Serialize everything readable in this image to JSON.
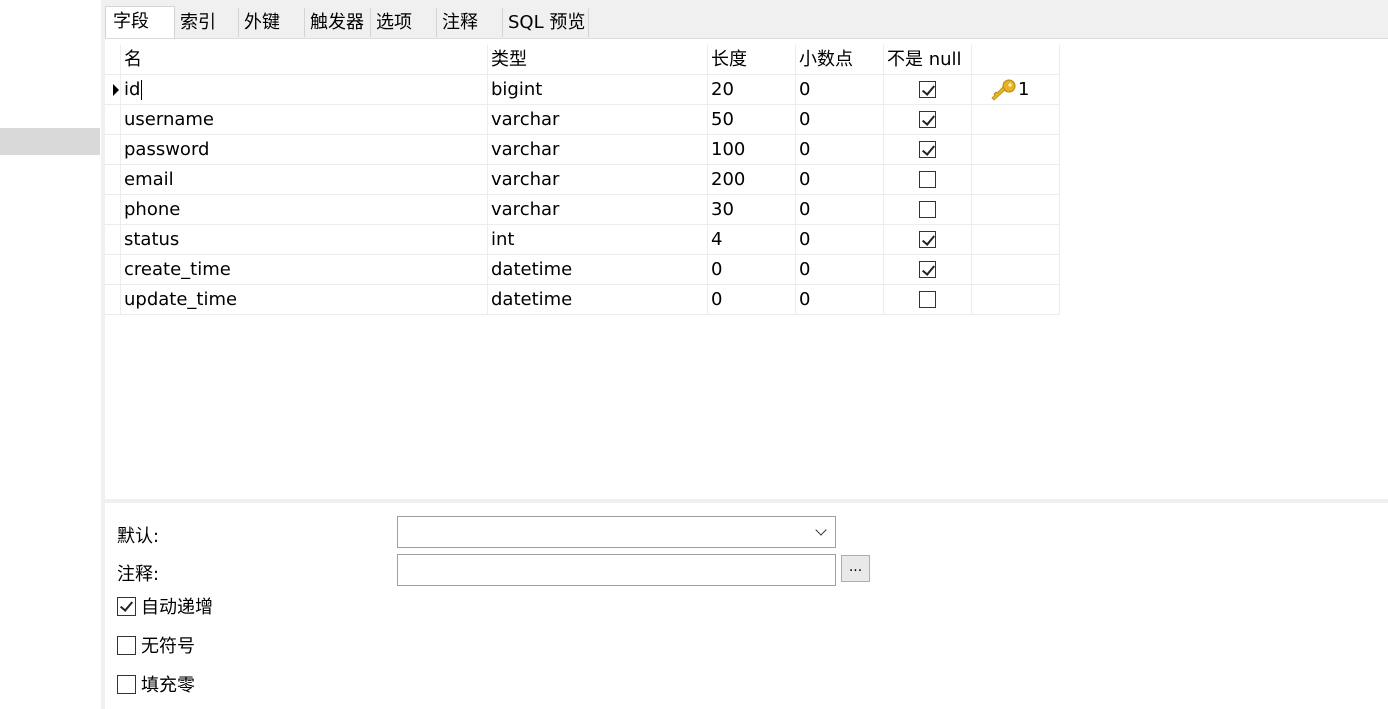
{
  "tabs": [
    {
      "label": "字段",
      "active": true
    },
    {
      "label": "索引"
    },
    {
      "label": "外键"
    },
    {
      "label": "触发器"
    },
    {
      "label": "选项"
    },
    {
      "label": "注释"
    },
    {
      "label": "SQL 预览"
    }
  ],
  "grid": {
    "headers": {
      "name": "名",
      "type": "类型",
      "length": "长度",
      "decimal": "小数点",
      "not_null": "不是 null",
      "key": ""
    },
    "rows": [
      {
        "name": "id",
        "type": "bigint",
        "length": "20",
        "decimal": "0",
        "not_null": true,
        "key": "1"
      },
      {
        "name": "username",
        "type": "varchar",
        "length": "50",
        "decimal": "0",
        "not_null": true,
        "key": ""
      },
      {
        "name": "password",
        "type": "varchar",
        "length": "100",
        "decimal": "0",
        "not_null": true,
        "key": ""
      },
      {
        "name": "email",
        "type": "varchar",
        "length": "200",
        "decimal": "0",
        "not_null": false,
        "key": ""
      },
      {
        "name": "phone",
        "type": "varchar",
        "length": "30",
        "decimal": "0",
        "not_null": false,
        "key": ""
      },
      {
        "name": "status",
        "type": "int",
        "length": "4",
        "decimal": "0",
        "not_null": true,
        "key": ""
      },
      {
        "name": "create_time",
        "type": "datetime",
        "length": "0",
        "decimal": "0",
        "not_null": true,
        "key": ""
      },
      {
        "name": "update_time",
        "type": "datetime",
        "length": "0",
        "decimal": "0",
        "not_null": false,
        "key": ""
      }
    ],
    "key_icon": "key-icon",
    "key_color": "#e8b422"
  },
  "props": {
    "default_label": "默认:",
    "default_value": "",
    "comment_label": "注释:",
    "comment_value": "",
    "more_label": "...",
    "options": [
      {
        "label": "自动递增",
        "checked": true
      },
      {
        "label": "无符号",
        "checked": false
      },
      {
        "label": "填充零",
        "checked": false
      }
    ]
  }
}
